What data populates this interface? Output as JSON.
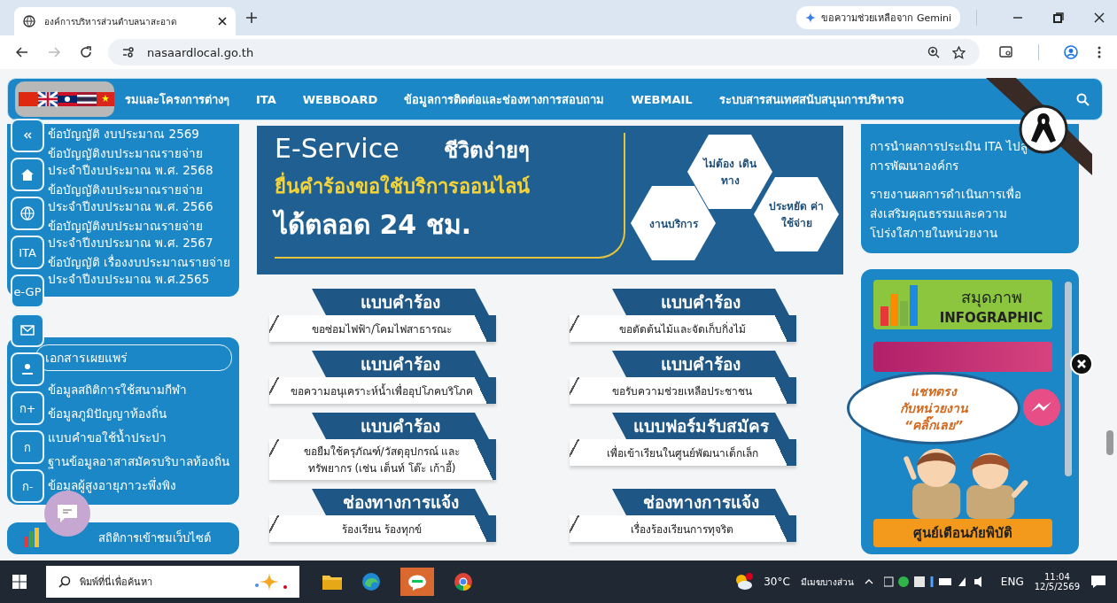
{
  "browser": {
    "tab_title": "องค์การบริหารส่วนตำบลนาสะอาด",
    "gemini_label": "ขอความช่วยเหลือจาก Gemini",
    "url": "nasaardlocal.go.th"
  },
  "nav": {
    "items": [
      "รมและโครงการต่างๆ",
      "ITA",
      "WEBBOARD",
      "ข้อมูลการติดต่อและช่องทางการสอบถาม",
      "WEBMAIL",
      "ระบบสารสนเทศสนับสนุนการบริหารจ"
    ]
  },
  "side_buttons": [
    {
      "kind": "collapse"
    },
    {
      "kind": "home"
    },
    {
      "kind": "globe"
    },
    {
      "kind": "text",
      "label": "ITA"
    },
    {
      "kind": "text",
      "label": "e-GP"
    },
    {
      "kind": "mail"
    },
    {
      "kind": "person"
    },
    {
      "kind": "text",
      "label": "ก+"
    },
    {
      "kind": "text",
      "label": "ก"
    },
    {
      "kind": "text",
      "label": "ก-"
    }
  ],
  "budget_links": [
    "ข้อบัญญัติ งบประมาณ 2569",
    "ข้อบัญญัติงบประมาณรายจ่าย ประจำปีงบประมาณ พ.ศ. 2568",
    "ข้อบัญญัติงบประมาณรายจ่าย ประจำปีงบประมาณ พ.ศ. 2566",
    "ข้อบัญญัติงบประมาณรายจ่าย ประจำปีงบประมาณ พ.ศ. 2567",
    "ข้อบัญญัติ เรื่องงบประมาณรายจ่าย ประจำปีงบประมาณ พ.ศ.2565"
  ],
  "documents": {
    "header": "เอกสารเผยแพร่",
    "links": [
      "ข้อมูลสถิติการใช้สนามกีฬา",
      "ข้อมูลภูมิปัญญาท้องถิ่น",
      "แบบคำขอใช้น้ำประปา",
      "ฐานข้อมูลอาสาสมัครบริบาลท้องถิ่น",
      "ข้อมูลผู้สูงอายุภาวะพึ่งพิง"
    ]
  },
  "stats_label": "สถิติการเข้าชมเว็บไซต์",
  "banner": {
    "title": "E-Service",
    "tagline": "ชีวิตง่ายๆ",
    "headline": "ยื่นคำร้องขอใช้บริการออนไลน์",
    "hours": "ได้ตลอด 24 ชม.",
    "hexagons": [
      "ไม่ต้อง เดินทาง",
      "งานบริการ",
      "ประหยัด ค่าใช้จ่าย"
    ]
  },
  "cards": [
    {
      "title": "แบบคำร้อง",
      "subtitle": "ขอซ่อมไฟฟ้า/โคมไฟสาธารณะ"
    },
    {
      "title": "แบบคำร้อง",
      "subtitle": "ขอตัดต้นไม้และจัดเก็บกิ่งไม้"
    },
    {
      "title": "แบบคำร้อง",
      "subtitle": "ขอความอนุเคราะห์น้ำเพื่ออุปโภคบริโภค"
    },
    {
      "title": "แบบคำร้อง",
      "subtitle": "ขอรับความช่วยเหลือประชาชน"
    },
    {
      "title": "แบบคำร้อง",
      "subtitle": "ขอยืมใช้ครุภัณฑ์/วัสดุอุปกรณ์ และทรัพยากร (เช่น เต็นท์ โต๊ะ เก้าอี้)"
    },
    {
      "title": "แบบฟอร์มรับสมัคร",
      "subtitle": "เพื่อเข้าเรียนในศูนย์พัฒนาเด็กเล็ก"
    },
    {
      "title": "ช่องทางการแจ้ง",
      "subtitle": "ร้องเรียน ร้องทุกข์"
    },
    {
      "title": "ช่องทางการแจ้ง",
      "subtitle": "เรื่องร้องเรียนการทุจริต"
    }
  ],
  "ita_links": [
    "การนำผลการประเมิน ITA ไปสู่การพัฒนาองค์กร",
    "รายงานผลการดำเนินการเพื่อส่งเสริมคุณธรรมและความโปร่งใสภายในหน่วยงาน"
  ],
  "infographic": {
    "line1": "สมุดภาพ",
    "line2": "INFOGRAPHIC"
  },
  "warning_banner": "ศูนย์เตือนภัยพิบัติ",
  "chat_bubble": [
    "แชทตรง",
    "กับหน่วยงาน",
    "“คลิ๊กเลย”"
  ],
  "taskbar": {
    "search_placeholder": "พิมพ์ที่นี่เพื่อค้นหา",
    "temperature": "30°C",
    "weather": "มีเมฆบางส่วน",
    "language": "ENG",
    "time": "11:04",
    "date": "12/5/2569"
  }
}
